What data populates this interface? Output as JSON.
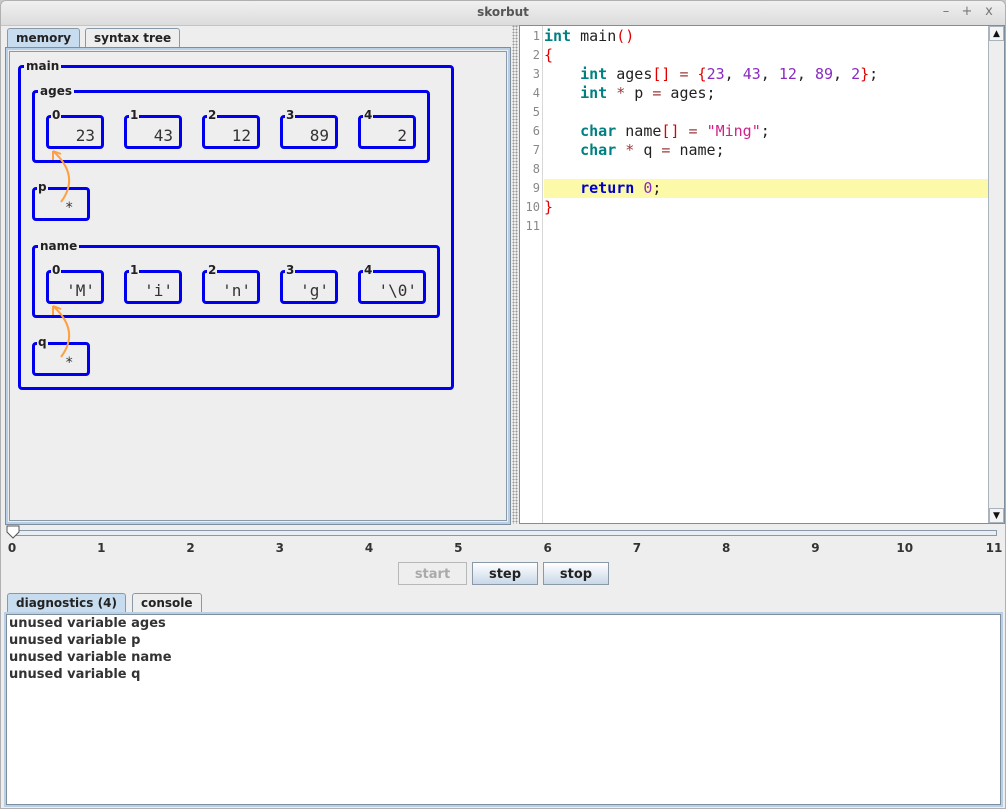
{
  "window": {
    "title": "skorbut",
    "controls": {
      "minimize": "–",
      "maximize": "+",
      "close": "x"
    }
  },
  "left_tabs": [
    {
      "label": "memory",
      "active": true
    },
    {
      "label": "syntax tree",
      "active": false
    }
  ],
  "memory": {
    "frame": "main",
    "ages": {
      "label": "ages",
      "cells": [
        {
          "index": "0",
          "value": "23"
        },
        {
          "index": "1",
          "value": "43"
        },
        {
          "index": "2",
          "value": "12"
        },
        {
          "index": "3",
          "value": "89"
        },
        {
          "index": "4",
          "value": "2"
        }
      ]
    },
    "p": {
      "label": "p",
      "value": "*",
      "points_to": "ages[0]"
    },
    "name": {
      "label": "name",
      "cells": [
        {
          "index": "0",
          "value": "'M'"
        },
        {
          "index": "1",
          "value": "'i'"
        },
        {
          "index": "2",
          "value": "'n'"
        },
        {
          "index": "3",
          "value": "'g'"
        },
        {
          "index": "4",
          "value": "'\\0'"
        }
      ]
    },
    "q": {
      "label": "q",
      "value": "*",
      "points_to": "name[0]"
    },
    "colors": {
      "box": "#0000ee",
      "arrow": "#ffa040"
    }
  },
  "editor": {
    "line_numbers": [
      "1",
      "2",
      "3",
      "4",
      "5",
      "6",
      "7",
      "8",
      "9",
      "10",
      "11"
    ],
    "highlighted_line": 9,
    "lines": [
      "int main()",
      "{",
      "    int ages[] = {23, 43, 12, 89, 2};",
      "    int * p = ages;",
      "",
      "    char name[] = \"Ming\";",
      "    char * q = name;",
      "",
      "    return 0;",
      "}",
      ""
    ]
  },
  "timeline": {
    "ticks": [
      "0",
      "1",
      "2",
      "3",
      "4",
      "5",
      "6",
      "7",
      "8",
      "9",
      "10",
      "11"
    ],
    "value": 0,
    "min": 0,
    "max": 11
  },
  "controls": {
    "start": {
      "label": "start",
      "enabled": false
    },
    "step": {
      "label": "step",
      "enabled": true
    },
    "stop": {
      "label": "stop",
      "enabled": true
    }
  },
  "bottom_tabs": [
    {
      "label": "diagnostics (4)",
      "active": true
    },
    {
      "label": "console",
      "active": false
    }
  ],
  "diagnostics": [
    "unused variable ages",
    "unused variable p",
    "unused variable name",
    "unused variable q"
  ]
}
